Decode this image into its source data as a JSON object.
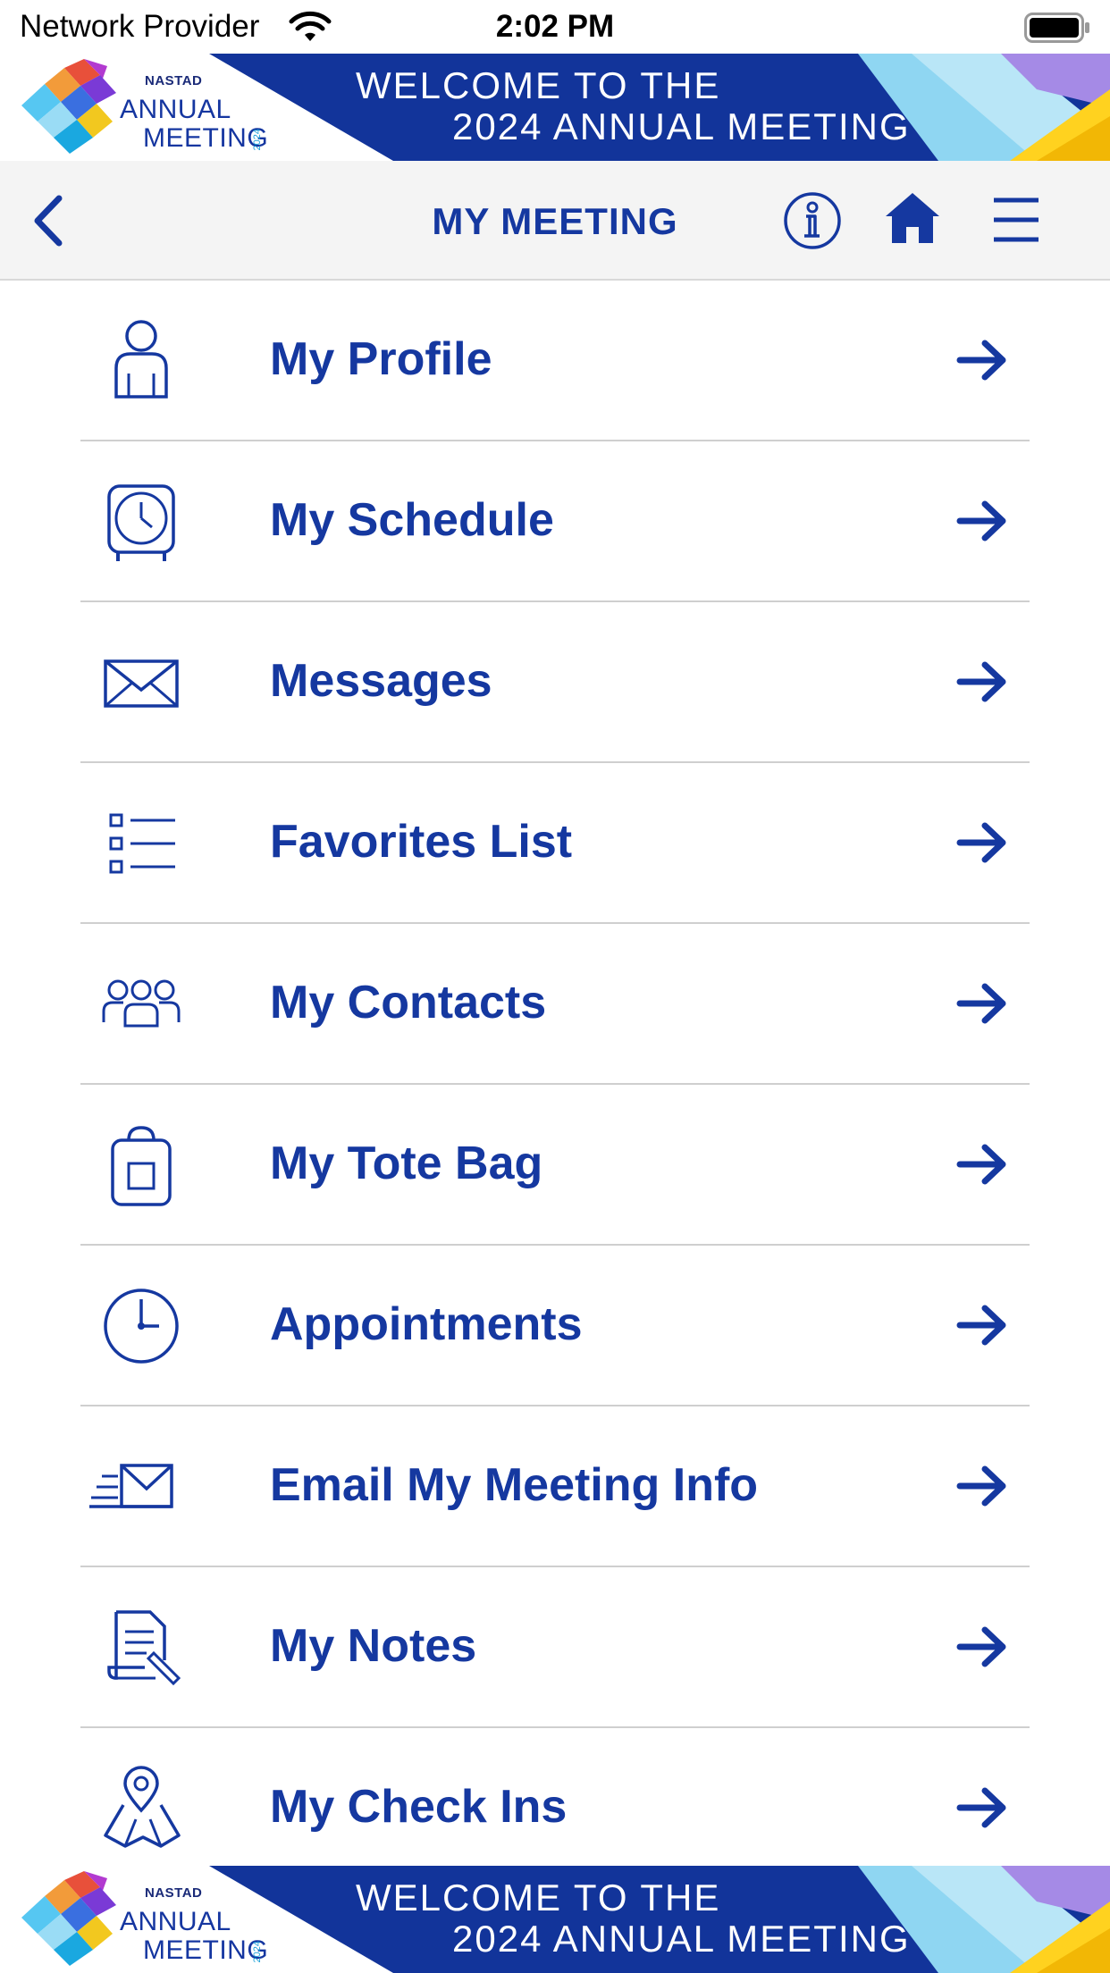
{
  "status_bar": {
    "carrier": "Network Provider",
    "time": "2:02 PM"
  },
  "banner": {
    "logo_org": "NASTAD",
    "logo_line1": "ANNUAL",
    "logo_line2": "MEETING",
    "logo_year": "2024",
    "line1": "WELCOME TO THE",
    "line2": "2024 ANNUAL MEETING"
  },
  "navbar": {
    "title": "MY MEETING",
    "back_icon": "chevron-left-icon",
    "info_icon": "info-icon",
    "home_icon": "home-icon",
    "menu_icon": "hamburger-icon"
  },
  "menu": {
    "items": [
      {
        "label": "My Profile",
        "icon": "person-icon"
      },
      {
        "label": "My Schedule",
        "icon": "clock-icon"
      },
      {
        "label": "Messages",
        "icon": "envelope-icon"
      },
      {
        "label": "Favorites List",
        "icon": "checklist-icon"
      },
      {
        "label": "My Contacts",
        "icon": "group-icon"
      },
      {
        "label": "My Tote Bag",
        "icon": "tote-bag-icon"
      },
      {
        "label": "Appointments",
        "icon": "clock-circle-icon"
      },
      {
        "label": "Email My Meeting Info",
        "icon": "send-mail-icon"
      },
      {
        "label": "My Notes",
        "icon": "notes-icon"
      },
      {
        "label": "My Check Ins",
        "icon": "map-pin-icon"
      }
    ]
  },
  "colors": {
    "primary": "#1538a0",
    "banner_blue": "#12349a",
    "nav_bg": "#f4f4f4",
    "divider": "#cfcfcf"
  }
}
